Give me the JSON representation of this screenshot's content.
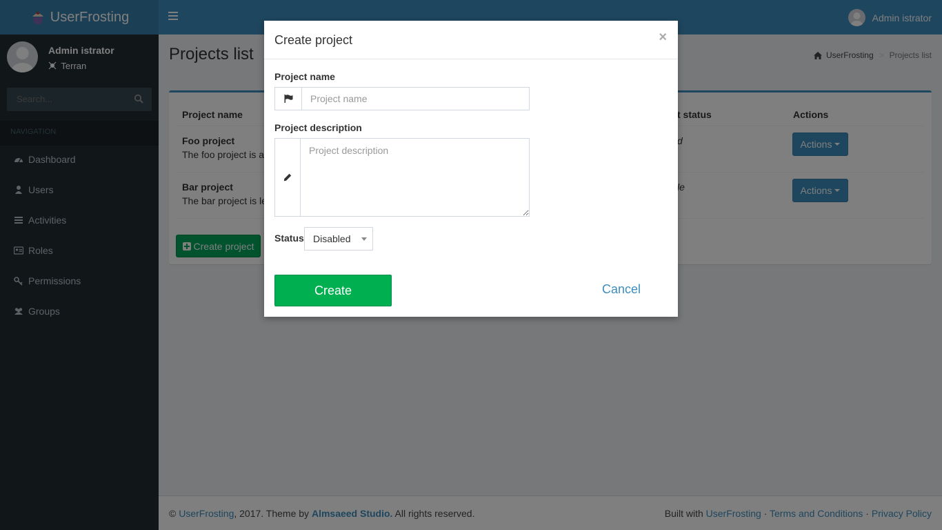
{
  "header": {
    "brand": "UserFrosting",
    "user_name": "Admin istrator"
  },
  "sidebar": {
    "user": {
      "name": "Admin istrator",
      "location": "Terran"
    },
    "search": {
      "placeholder": "Search..."
    },
    "nav_header": "NAVIGATION",
    "items": [
      {
        "label": "Dashboard",
        "icon": "dashboard-icon"
      },
      {
        "label": "Users",
        "icon": "user-icon"
      },
      {
        "label": "Activities",
        "icon": "list-icon"
      },
      {
        "label": "Roles",
        "icon": "id-card-icon"
      },
      {
        "label": "Permissions",
        "icon": "key-icon"
      },
      {
        "label": "Groups",
        "icon": "users-icon"
      }
    ]
  },
  "main": {
    "title": "Projects list",
    "breadcrumb": {
      "home": "UserFrosting",
      "current": "Projects list"
    },
    "table": {
      "columns": [
        "Project name",
        "t status",
        "Actions"
      ],
      "rows": [
        {
          "name": "Foo project",
          "description": "The foo project is aw",
          "status": "d",
          "action": "Actions"
        },
        {
          "name": "Bar project",
          "description": "The bar project is les",
          "status": "le",
          "action": "Actions"
        }
      ]
    },
    "create_button": "Create project"
  },
  "footer": {
    "copyright_prefix": "©",
    "brand": "UserFrosting",
    "year_text": ", 2017. Theme by",
    "theme_author": "Almsaeed Studio.",
    "rights": "All rights reserved.",
    "built_with": "Built with",
    "built_link": "UserFrosting",
    "sep": "·",
    "terms": "Terms and Conditions",
    "privacy": "Privacy Policy"
  },
  "modal": {
    "title": "Create project",
    "close": "×",
    "name_label": "Project name",
    "name_placeholder": "Project name",
    "name_value": "",
    "desc_label": "Project description",
    "desc_placeholder": "Project description",
    "desc_value": "",
    "status_label": "Status",
    "status_value": "Disabled",
    "create": "Create",
    "cancel": "Cancel"
  },
  "colors": {
    "header": "#3c8dbc",
    "sidebar": "#222d32",
    "success": "#00a65a",
    "primary": "#3c8dbc"
  }
}
